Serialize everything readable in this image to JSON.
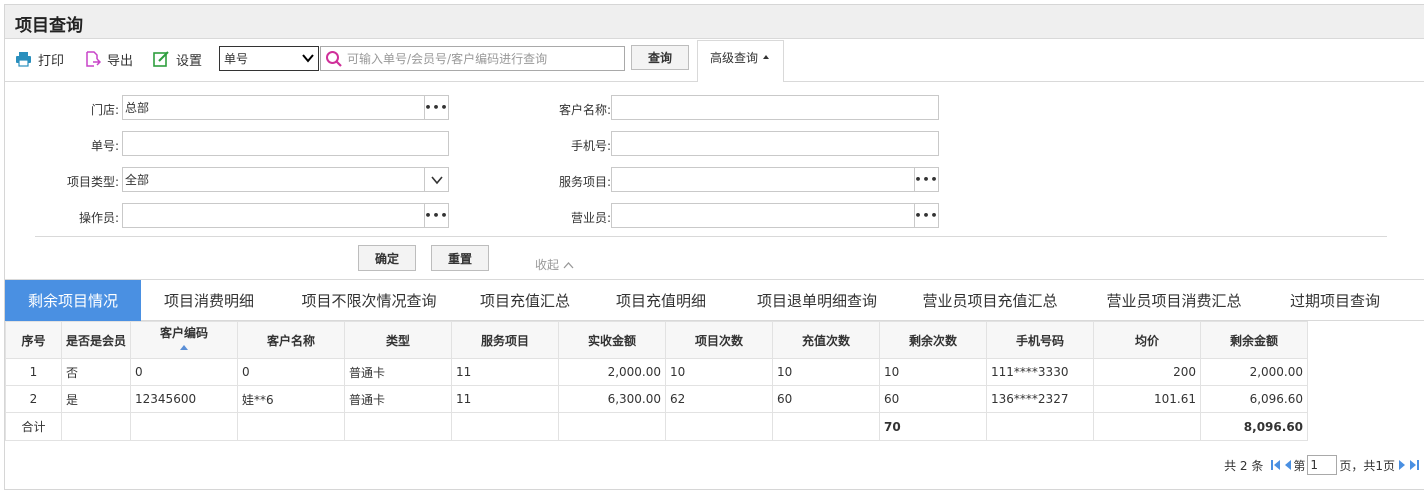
{
  "page": {
    "title": "项目查询"
  },
  "toolbar": {
    "print_label": "打印",
    "export_label": "导出",
    "settings_label": "设置",
    "search_type_value": "单号",
    "search_placeholder": "可输入单号/会员号/客户编码进行查询",
    "query_label": "查询",
    "advanced_label": "高级查询"
  },
  "form": {
    "store_label": "门店:",
    "store_value": "总部",
    "customer_name_label": "客户名称:",
    "order_no_label": "单号:",
    "phone_label": "手机号:",
    "item_type_label": "项目类型:",
    "item_type_value": "全部",
    "service_item_label": "服务项目:",
    "operator_label": "操作员:",
    "salesperson_label": "营业员:",
    "confirm_label": "确定",
    "reset_label": "重置",
    "collapse_label": "收起"
  },
  "tabs": [
    {
      "label": "剩余项目情况",
      "active": true
    },
    {
      "label": "项目消费明细"
    },
    {
      "label": "项目不限次情况查询"
    },
    {
      "label": "项目充值汇总"
    },
    {
      "label": "项目充值明细"
    },
    {
      "label": "项目退单明细查询"
    },
    {
      "label": "营业员项目充值汇总"
    },
    {
      "label": "营业员项目消费汇总"
    },
    {
      "label": "过期项目查询"
    }
  ],
  "table": {
    "columns": [
      "序号",
      "是否是会员",
      "客户编码",
      "客户名称",
      "类型",
      "服务项目",
      "实收金额",
      "项目次数",
      "充值次数",
      "剩余次数",
      "手机号码",
      "均价",
      "剩余金额"
    ],
    "rows": [
      [
        "1",
        "否",
        "0",
        "0",
        "普通卡",
        "11",
        "2,000.00",
        "10",
        "10",
        "10",
        "111****3330",
        "200",
        "2,000.00"
      ],
      [
        "2",
        "是",
        "12345600",
        "娃**6",
        "普通卡",
        "11",
        "6,300.00",
        "62",
        "60",
        "60",
        "136****2327",
        "101.61",
        "6,096.60"
      ]
    ],
    "total": {
      "label": "合计",
      "remaining_count": "70",
      "remaining_amount": "8,096.60"
    }
  },
  "pager": {
    "total_text": "共 2 条",
    "page_prefix": "第",
    "page_value": "1",
    "page_suffix": "页，共1页"
  },
  "colors": {
    "accent": "#4a90e2",
    "print_icon": "#2a8fbd",
    "export_icon": "#c844c8",
    "settings_icon": "#2e9e3e",
    "search_icon": "#d0309a"
  }
}
